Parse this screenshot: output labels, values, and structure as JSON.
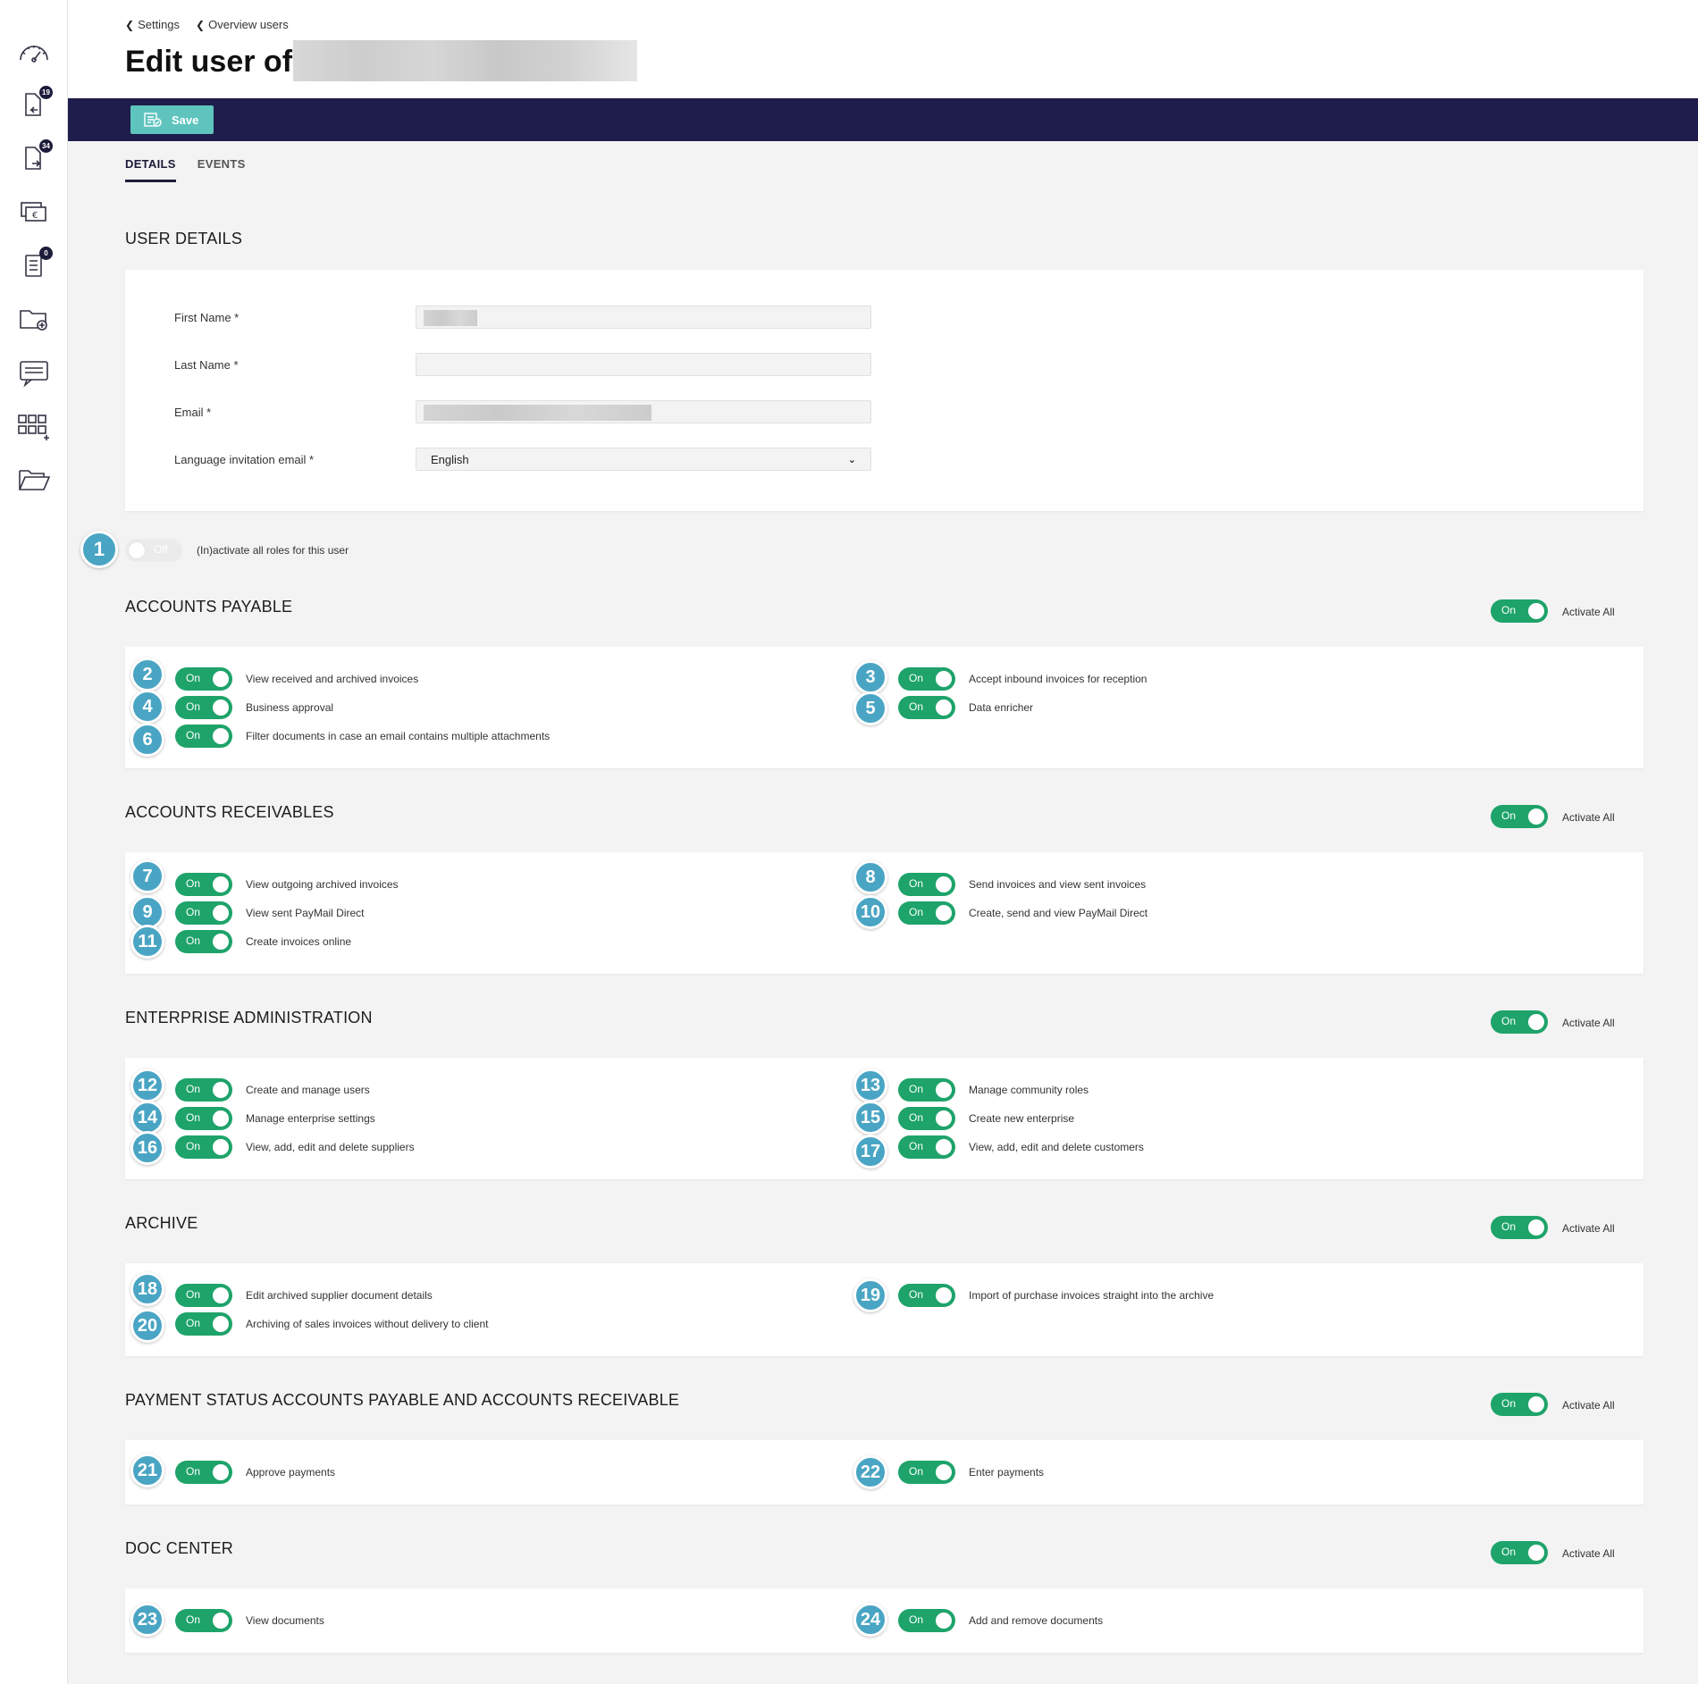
{
  "breadcrumb": {
    "settings": "Settings",
    "overview": "Overview users"
  },
  "page": {
    "title": "Edit user of"
  },
  "toolbar": {
    "save_label": "Save"
  },
  "tabs": [
    {
      "label": "DETAILS"
    },
    {
      "label": "EVENTS"
    }
  ],
  "user_details": {
    "title": "USER DETAILS",
    "first_name_label": "First Name *",
    "last_name_label": "Last Name *",
    "email_label": "Email *",
    "language_label": "Language invitation email *",
    "language_value": "English"
  },
  "sidebar": {
    "badge_1": "19",
    "badge_2": "34",
    "badge_3": "0"
  },
  "master_toggle": {
    "state": "Off",
    "label": "(In)activate all roles for this user",
    "marker": "1"
  },
  "on_label": "On",
  "activate_all_label": "Activate All",
  "sections": {
    "ap": {
      "title": "ACCOUNTS PAYABLE",
      "roles": [
        {
          "marker": "2",
          "label": "View received and archived invoices"
        },
        {
          "marker": "3",
          "label": "Accept inbound invoices for reception"
        },
        {
          "marker": "4",
          "label": "Business approval"
        },
        {
          "marker": "5",
          "label": "Data enricher"
        },
        {
          "marker": "6",
          "label": "Filter documents in case an email contains multiple attachments"
        }
      ]
    },
    "ar": {
      "title": "ACCOUNTS RECEIVABLES",
      "roles": [
        {
          "marker": "7",
          "label": "View outgoing archived invoices"
        },
        {
          "marker": "8",
          "label": "Send invoices and view sent invoices"
        },
        {
          "marker": "9",
          "label": "View sent PayMail Direct"
        },
        {
          "marker": "10",
          "label": "Create, send and view PayMail Direct"
        },
        {
          "marker": "11",
          "label": "Create invoices online"
        }
      ]
    },
    "ea": {
      "title": "ENTERPRISE ADMINISTRATION",
      "roles": [
        {
          "marker": "12",
          "label": "Create and manage users"
        },
        {
          "marker": "13",
          "label": "Manage community roles"
        },
        {
          "marker": "14",
          "label": "Manage enterprise settings"
        },
        {
          "marker": "15",
          "label": "Create new enterprise"
        },
        {
          "marker": "16",
          "label": "View, add, edit and delete suppliers"
        },
        {
          "marker": "17",
          "label": "View, add, edit and delete customers"
        }
      ]
    },
    "archive": {
      "title": "ARCHIVE",
      "roles": [
        {
          "marker": "18",
          "label": "Edit archived supplier document details"
        },
        {
          "marker": "19",
          "label": "Import of purchase invoices straight into the archive"
        },
        {
          "marker": "20",
          "label": "Archiving of sales invoices without delivery to client"
        }
      ]
    },
    "ps": {
      "title": "PAYMENT STATUS ACCOUNTS PAYABLE AND ACCOUNTS RECEIVABLE",
      "roles": [
        {
          "marker": "21",
          "label": "Approve payments"
        },
        {
          "marker": "22",
          "label": "Enter payments"
        }
      ]
    },
    "dc": {
      "title": "DOC CENTER",
      "roles": [
        {
          "marker": "23",
          "label": "View documents"
        },
        {
          "marker": "24",
          "label": "Add and remove documents"
        }
      ]
    }
  },
  "colors": {
    "accent_green": "#1ea36a",
    "toolbar_navy": "#1e1d4c",
    "save_teal": "#5fc4be",
    "marker_blue": "#4aa5c4"
  },
  "icons": [
    "dashboard-icon",
    "inbound-documents-icon",
    "outbound-documents-icon",
    "payments-icon",
    "tasks-icon",
    "folder-add-icon",
    "messages-icon",
    "apps-icon",
    "folder-open-icon",
    "save-icon",
    "chevron-left-icon",
    "chevron-down-icon"
  ]
}
